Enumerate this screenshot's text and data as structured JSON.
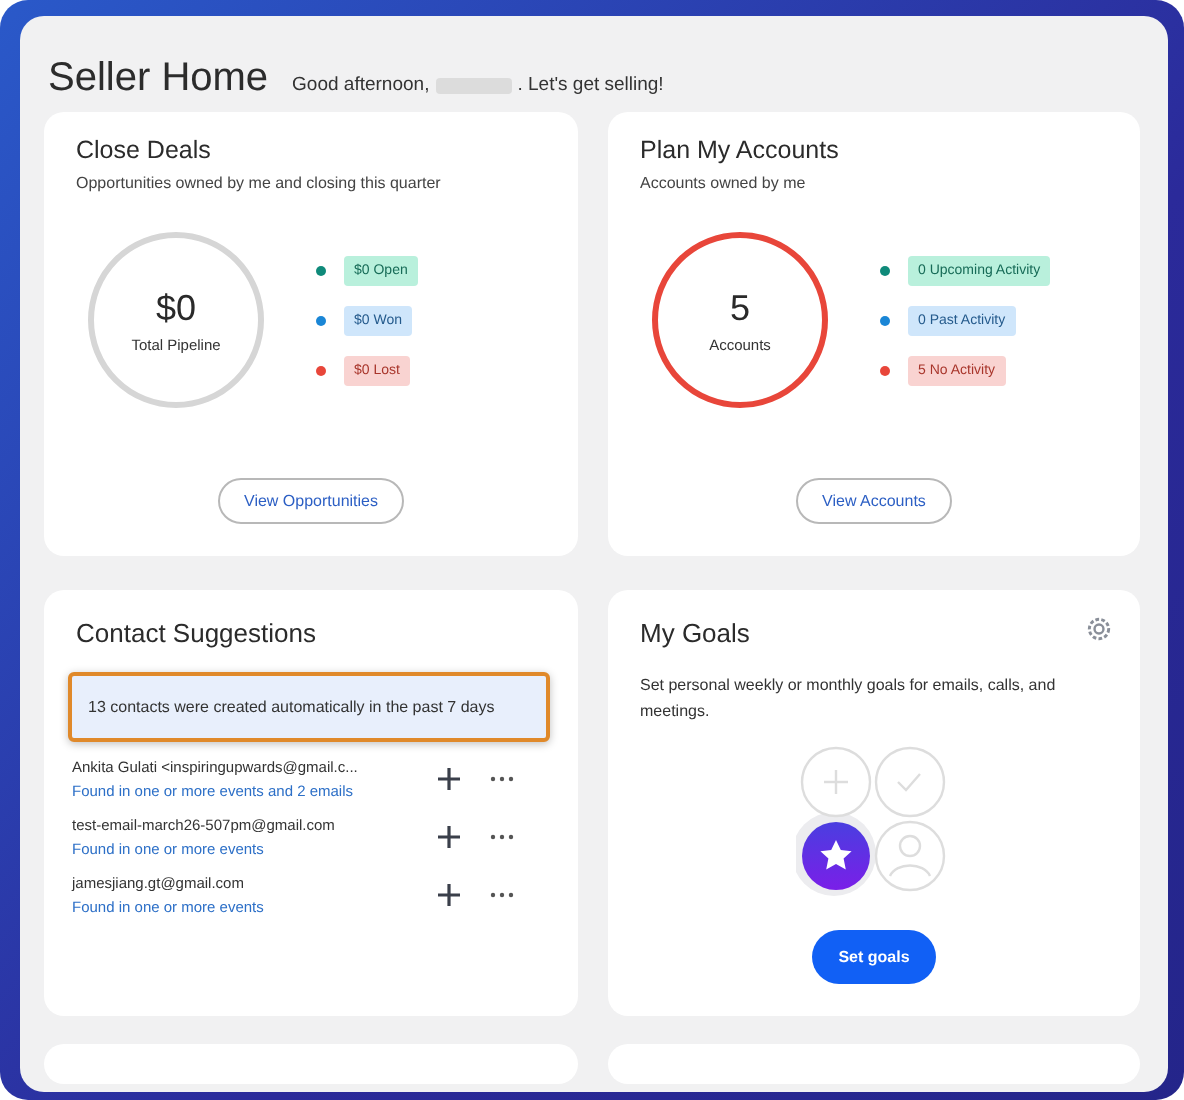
{
  "header": {
    "title": "Seller Home",
    "greeting_before": "Good afternoon,",
    "greeting_after": ". Let's get selling!"
  },
  "summary_cards": [
    {
      "title": "Close Deals",
      "subtitle": "Opportunities owned by me and closing this quarter",
      "ring": {
        "value": "$0",
        "label": "Total Pipeline",
        "kind": "neutral"
      },
      "legend": [
        {
          "label": "$0 Open",
          "color": "#0f8a7a",
          "kind": "green"
        },
        {
          "label": "$0 Won",
          "color": "#1a86d6",
          "kind": "blue"
        },
        {
          "label": "$0 Lost",
          "color": "#e8463a",
          "kind": "red"
        }
      ],
      "button": "View Opportunities"
    },
    {
      "title": "Plan My Accounts",
      "subtitle": "Accounts owned by me",
      "ring": {
        "value": "5",
        "label": "Accounts",
        "kind": "alert"
      },
      "legend": [
        {
          "label": "0 Upcoming Activity",
          "color": "#0f8a7a",
          "kind": "green"
        },
        {
          "label": "0 Past Activity",
          "color": "#1a86d6",
          "kind": "blue"
        },
        {
          "label": "5 No Activity",
          "color": "#e8463a",
          "kind": "red"
        }
      ],
      "button": "View Accounts"
    }
  ],
  "contact_suggestions": {
    "title": "Contact Suggestions",
    "banner": {
      "text": "13 contacts were created automatically in the past 7 days",
      "highlighted": true
    },
    "contacts": [
      {
        "name": "Ankita Gulati <inspiringupwards@gmail.c...",
        "note": "Found in one or more events and 2 emails"
      },
      {
        "name": "test-email-march26-507pm@gmail.com",
        "note": "Found in one or more events"
      },
      {
        "name": "jamesjiang.gt@gmail.com",
        "note": "Found in one or more events"
      }
    ]
  },
  "my_goals": {
    "title": "My Goals",
    "description": "Set personal weekly or monthly goals for emails, calls, and meetings.",
    "button": "Set goals"
  }
}
